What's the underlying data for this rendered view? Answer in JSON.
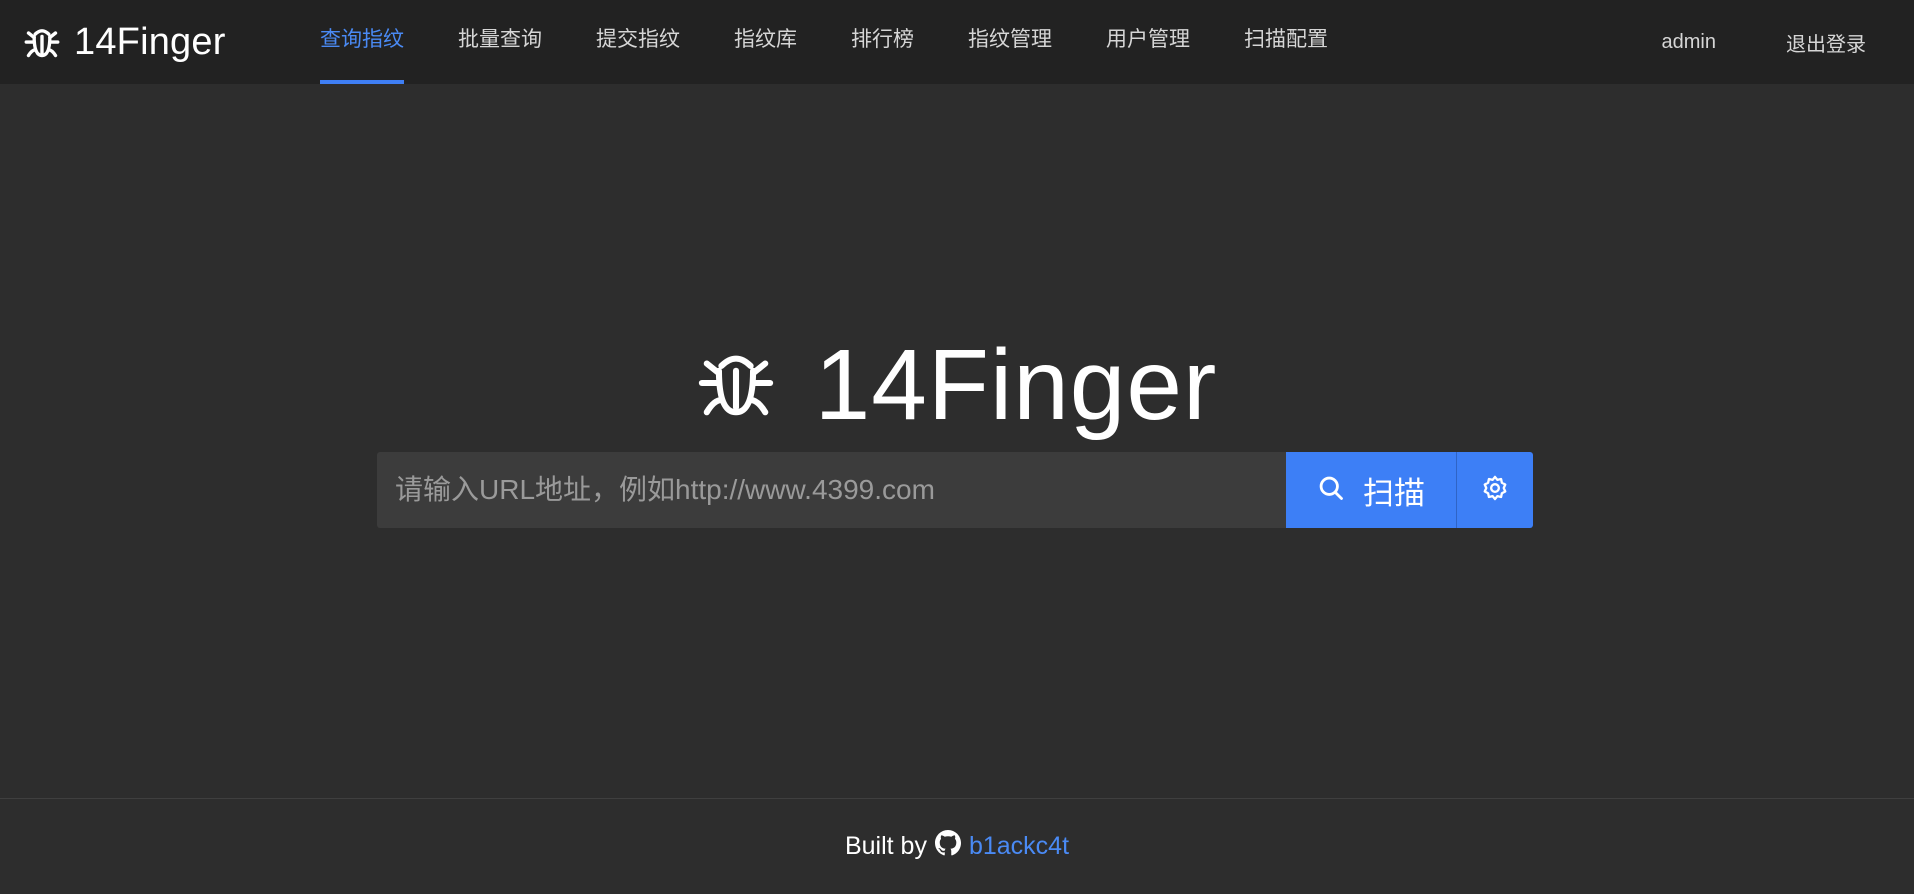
{
  "app": {
    "brand_name": "14Finger",
    "brand_icon": "bug-icon"
  },
  "nav": {
    "items": [
      {
        "label": "查询指纹",
        "active": true
      },
      {
        "label": "批量查询",
        "active": false
      },
      {
        "label": "提交指纹",
        "active": false
      },
      {
        "label": "指纹库",
        "active": false
      },
      {
        "label": "排行榜",
        "active": false
      },
      {
        "label": "指纹管理",
        "active": false
      },
      {
        "label": "用户管理",
        "active": false
      },
      {
        "label": "扫描配置",
        "active": false
      }
    ]
  },
  "user": {
    "username": "admin",
    "logout_label": "退出登录"
  },
  "hero": {
    "title": "14Finger",
    "icon": "bug-icon"
  },
  "search": {
    "value": "",
    "placeholder": "请输入URL地址，例如http://www.4399.com",
    "scan_label": "扫描",
    "scan_icon": "search-icon",
    "settings_icon": "gear-icon"
  },
  "footer": {
    "prefix": "Built by",
    "link_icon": "github-icon",
    "link_label": "b1ackc4t"
  },
  "colors": {
    "accent": "#3d7ff6",
    "header_bg": "#222222",
    "page_bg": "#2d2d2d",
    "input_bg": "#3c3c3c"
  }
}
